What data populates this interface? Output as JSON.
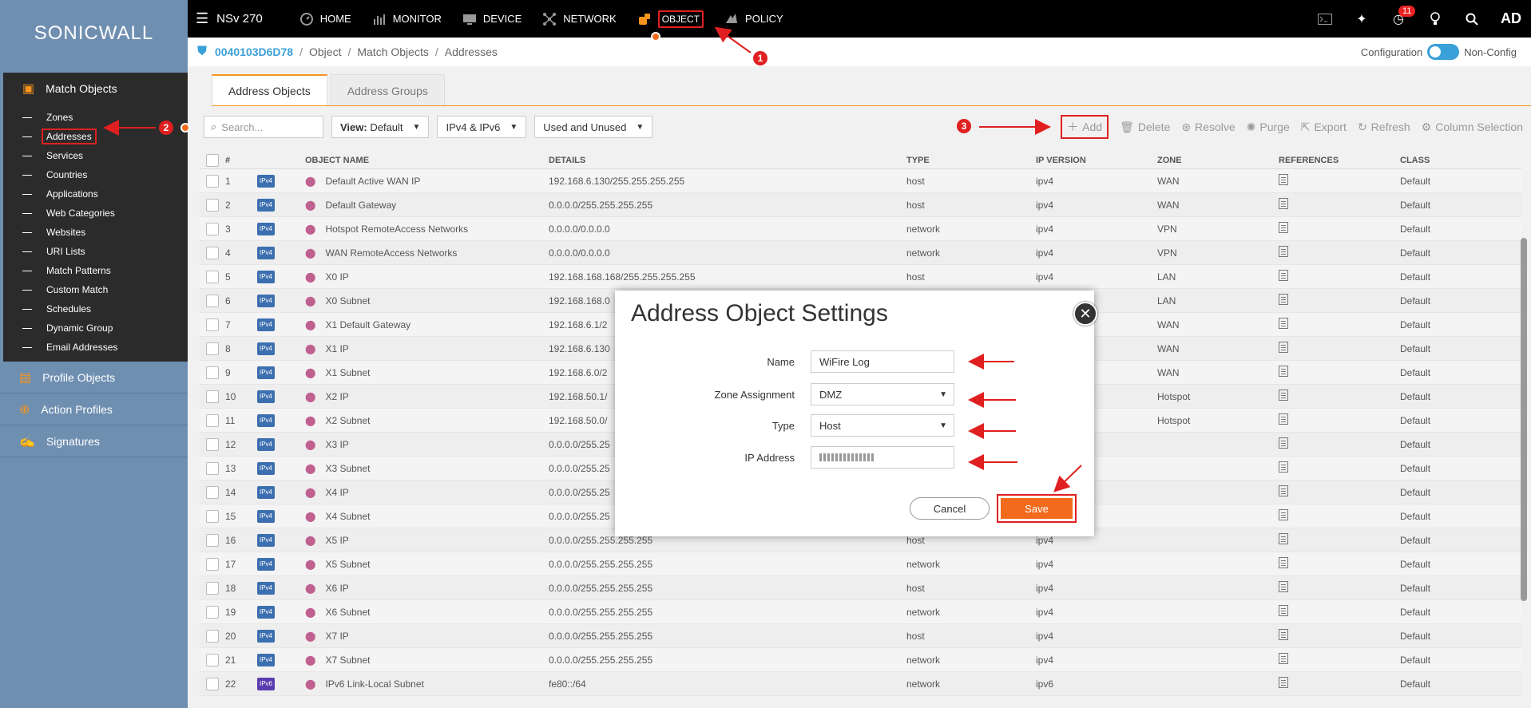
{
  "brand": "SONICWALL",
  "topnav": {
    "model": "NSv 270",
    "items": [
      "HOME",
      "MONITOR",
      "DEVICE",
      "NETWORK",
      "OBJECT",
      "POLICY"
    ],
    "notif_count": "11",
    "user": "AD"
  },
  "breadcrumb": {
    "device": "0040103D6D78",
    "parts": [
      "Object",
      "Match Objects",
      "Addresses"
    ],
    "config_left": "Configuration",
    "config_right": "Non-Config"
  },
  "sidebar": {
    "section": "Match Objects",
    "items": [
      "Zones",
      "Addresses",
      "Services",
      "Countries",
      "Applications",
      "Web Categories",
      "Websites",
      "URI Lists",
      "Match Patterns",
      "Custom Match",
      "Schedules",
      "Dynamic Group",
      "Email Addresses"
    ],
    "groups": [
      "Profile Objects",
      "Action Profiles",
      "Signatures"
    ]
  },
  "tabs": [
    "Address Objects",
    "Address Groups"
  ],
  "toolbar": {
    "search_placeholder": "Search...",
    "view_label": "View:",
    "view_value": "Default",
    "ipver": "IPv4 & IPv6",
    "usage": "Used and Unused",
    "actions": [
      "Add",
      "Delete",
      "Resolve",
      "Purge",
      "Export",
      "Refresh",
      "Column Selection"
    ]
  },
  "table": {
    "headers": [
      "#",
      "OBJECT NAME",
      "DETAILS",
      "TYPE",
      "IP VERSION",
      "ZONE",
      "REFERENCES",
      "CLASS"
    ],
    "rows": [
      {
        "n": "1",
        "v": "IPv4",
        "name": "Default Active WAN IP",
        "det": "192.168.6.130/255.255.255.255",
        "type": "host",
        "ipv": "ipv4",
        "zone": "WAN",
        "cls": "Default"
      },
      {
        "n": "2",
        "v": "IPv4",
        "name": "Default Gateway",
        "det": "0.0.0.0/255.255.255.255",
        "type": "host",
        "ipv": "ipv4",
        "zone": "WAN",
        "cls": "Default"
      },
      {
        "n": "3",
        "v": "IPv4",
        "name": "Hotspot RemoteAccess Networks",
        "det": "0.0.0.0/0.0.0.0",
        "type": "network",
        "ipv": "ipv4",
        "zone": "VPN",
        "cls": "Default"
      },
      {
        "n": "4",
        "v": "IPv4",
        "name": "WAN RemoteAccess Networks",
        "det": "0.0.0.0/0.0.0.0",
        "type": "network",
        "ipv": "ipv4",
        "zone": "VPN",
        "cls": "Default"
      },
      {
        "n": "5",
        "v": "IPv4",
        "name": "X0 IP",
        "det": "192.168.168.168/255.255.255.255",
        "type": "host",
        "ipv": "ipv4",
        "zone": "LAN",
        "cls": "Default"
      },
      {
        "n": "6",
        "v": "IPv4",
        "name": "X0 Subnet",
        "det": "192.168.168.0",
        "type": "",
        "ipv": "",
        "zone": "LAN",
        "cls": "Default"
      },
      {
        "n": "7",
        "v": "IPv4",
        "name": "X1 Default Gateway",
        "det": "192.168.6.1/2",
        "type": "",
        "ipv": "",
        "zone": "WAN",
        "cls": "Default"
      },
      {
        "n": "8",
        "v": "IPv4",
        "name": "X1 IP",
        "det": "192.168.6.130",
        "type": "",
        "ipv": "",
        "zone": "WAN",
        "cls": "Default"
      },
      {
        "n": "9",
        "v": "IPv4",
        "name": "X1 Subnet",
        "det": "192.168.6.0/2",
        "type": "",
        "ipv": "",
        "zone": "WAN",
        "cls": "Default"
      },
      {
        "n": "10",
        "v": "IPv4",
        "name": "X2 IP",
        "det": "192.168.50.1/",
        "type": "",
        "ipv": "",
        "zone": "Hotspot",
        "cls": "Default"
      },
      {
        "n": "11",
        "v": "IPv4",
        "name": "X2 Subnet",
        "det": "192.168.50.0/",
        "type": "",
        "ipv": "",
        "zone": "Hotspot",
        "cls": "Default"
      },
      {
        "n": "12",
        "v": "IPv4",
        "name": "X3 IP",
        "det": "0.0.0.0/255.25",
        "type": "",
        "ipv": "",
        "zone": "",
        "cls": "Default"
      },
      {
        "n": "13",
        "v": "IPv4",
        "name": "X3 Subnet",
        "det": "0.0.0.0/255.25",
        "type": "",
        "ipv": "",
        "zone": "",
        "cls": "Default"
      },
      {
        "n": "14",
        "v": "IPv4",
        "name": "X4 IP",
        "det": "0.0.0.0/255.25",
        "type": "",
        "ipv": "",
        "zone": "",
        "cls": "Default"
      },
      {
        "n": "15",
        "v": "IPv4",
        "name": "X4 Subnet",
        "det": "0.0.0.0/255.25",
        "type": "",
        "ipv": "",
        "zone": "",
        "cls": "Default"
      },
      {
        "n": "16",
        "v": "IPv4",
        "name": "X5 IP",
        "det": "0.0.0.0/255.255.255.255",
        "type": "host",
        "ipv": "ipv4",
        "zone": "",
        "cls": "Default"
      },
      {
        "n": "17",
        "v": "IPv4",
        "name": "X5 Subnet",
        "det": "0.0.0.0/255.255.255.255",
        "type": "network",
        "ipv": "ipv4",
        "zone": "",
        "cls": "Default"
      },
      {
        "n": "18",
        "v": "IPv4",
        "name": "X6 IP",
        "det": "0.0.0.0/255.255.255.255",
        "type": "host",
        "ipv": "ipv4",
        "zone": "",
        "cls": "Default"
      },
      {
        "n": "19",
        "v": "IPv4",
        "name": "X6 Subnet",
        "det": "0.0.0.0/255.255.255.255",
        "type": "network",
        "ipv": "ipv4",
        "zone": "",
        "cls": "Default"
      },
      {
        "n": "20",
        "v": "IPv4",
        "name": "X7 IP",
        "det": "0.0.0.0/255.255.255.255",
        "type": "host",
        "ipv": "ipv4",
        "zone": "",
        "cls": "Default"
      },
      {
        "n": "21",
        "v": "IPv4",
        "name": "X7 Subnet",
        "det": "0.0.0.0/255.255.255.255",
        "type": "network",
        "ipv": "ipv4",
        "zone": "",
        "cls": "Default"
      },
      {
        "n": "22",
        "v": "IPv6",
        "name": "IPv6 Link-Local Subnet",
        "det": "fe80::/64",
        "type": "network",
        "ipv": "ipv6",
        "zone": "",
        "cls": "Default"
      }
    ]
  },
  "modal": {
    "title": "Address Object Settings",
    "name_label": "Name",
    "name_value": "WiFire Log",
    "zone_label": "Zone Assignment",
    "zone_value": "DMZ",
    "type_label": "Type",
    "type_value": "Host",
    "ip_label": "IP Address",
    "ip_value": "",
    "cancel": "Cancel",
    "save": "Save"
  },
  "annotations": [
    "1",
    "2",
    "3"
  ]
}
